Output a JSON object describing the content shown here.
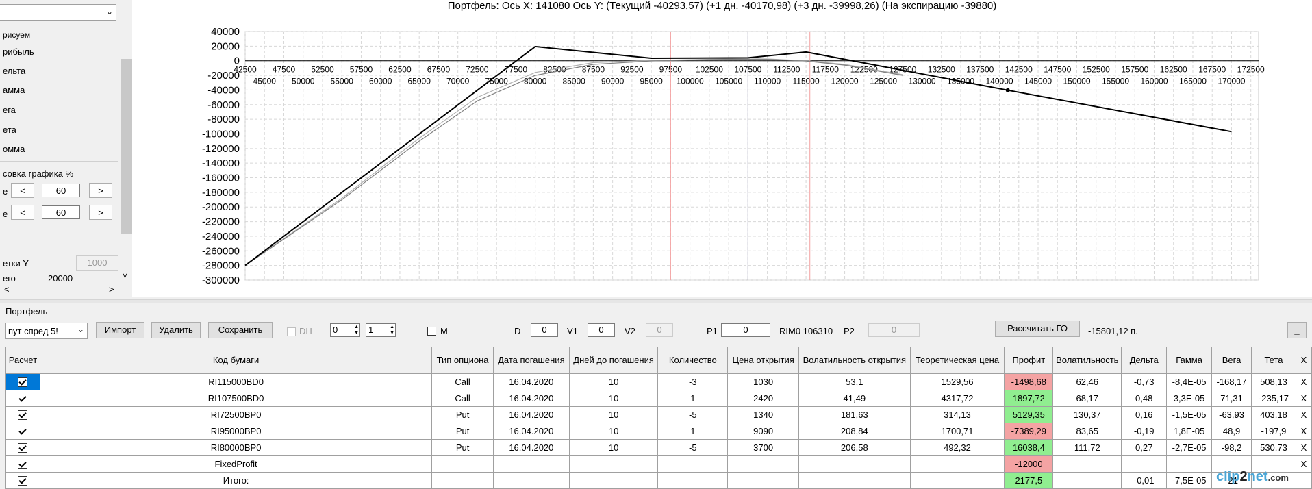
{
  "left_panel": {
    "items": [
      "рисуем",
      "рибыль",
      "ельта",
      "амма",
      "ега",
      "ета",
      "омма"
    ],
    "scale_label": "совка графика %",
    "row1_prefix": "е",
    "row2_prefix": "е",
    "btn_left": "<",
    "btn_right": ">",
    "value1": "60",
    "value2": "60",
    "grid_y_label": "етки Y",
    "grid_y_value": "1000",
    "total_label": "его",
    "total_value": "20000",
    "scroll_left": "<",
    "scroll_right": ">",
    "chevron": "˅"
  },
  "chart_title": "Портфель: Ось X: 141080 Ось Y:  (Текущий -40293,57)  (+1 дн. -40170,98)  (+3 дн. -39998,26)  (На экспирацию -39880)",
  "chart_data": {
    "type": "line",
    "y_ticks": [
      "40000",
      "20000",
      "0",
      "-20000",
      "-40000",
      "-60000",
      "-80000",
      "-100000",
      "-120000",
      "-140000",
      "-160000",
      "-180000",
      "-200000",
      "-220000",
      "-240000",
      "-260000",
      "-280000",
      "-300000"
    ],
    "x_ticks_top": [
      "42500",
      "47500",
      "52500",
      "57500",
      "62500",
      "67500",
      "72500",
      "77500",
      "82500",
      "87500",
      "92500",
      "97500",
      "102500",
      "107500",
      "112500",
      "117500",
      "122500",
      "127500",
      "132500",
      "137500",
      "142500",
      "147500",
      "152500",
      "157500",
      "162500",
      "167500",
      "172500"
    ],
    "x_ticks_bottom": [
      "45000",
      "50000",
      "55000",
      "60000",
      "65000",
      "70000",
      "75000",
      "80000",
      "85000",
      "90000",
      "95000",
      "100000",
      "105000",
      "110000",
      "115000",
      "120000",
      "125000",
      "130000",
      "135000",
      "140000",
      "145000",
      "150000",
      "155000",
      "160000",
      "165000",
      "170000"
    ],
    "xlim": [
      42500,
      173500
    ],
    "ylim": [
      -300000,
      40000
    ],
    "grid": true,
    "series": [
      {
        "color": "#000000",
        "points": [
          [
            42500,
            -280000
          ],
          [
            80000,
            19500
          ],
          [
            95000,
            3500
          ],
          [
            107500,
            4000
          ],
          [
            115000,
            12000
          ],
          [
            141080,
            -40293.57
          ],
          [
            170000,
            -97000
          ]
        ]
      },
      {
        "color": "#808080",
        "points": [
          [
            42500,
            -280000
          ],
          [
            55000,
            -190000
          ],
          [
            65000,
            -110000
          ],
          [
            72500,
            -55000
          ],
          [
            80000,
            -20000
          ],
          [
            87500,
            -5000
          ],
          [
            95000,
            -300
          ],
          [
            105000,
            2000
          ],
          [
            110000,
            2000
          ],
          [
            115000,
            -500
          ],
          [
            120000,
            -6000
          ],
          [
            127500,
            -20000
          ]
        ]
      },
      {
        "color": "#b0b0b0",
        "points": [
          [
            42500,
            -280000
          ],
          [
            55000,
            -188000
          ],
          [
            65000,
            -106000
          ],
          [
            72500,
            -50000
          ],
          [
            80000,
            -16000
          ],
          [
            87500,
            -2500
          ],
          [
            95000,
            300
          ],
          [
            105000,
            2500
          ],
          [
            110000,
            2500
          ],
          [
            115000,
            0
          ],
          [
            120000,
            -5000
          ],
          [
            127500,
            -19000
          ]
        ]
      }
    ],
    "vlines": [
      {
        "x": 97500,
        "color": "#f4a0a0"
      },
      {
        "x": 107500,
        "color": "#7a7a9a"
      },
      {
        "x": 115500,
        "color": "#f4a0a0"
      }
    ],
    "marker": {
      "x": 141080,
      "y": -40293.57
    }
  },
  "portfolio": {
    "group_label": "Портфель",
    "combo_value": "пут спред 5!",
    "btn_import": "Импорт",
    "btn_delete": "Удалить",
    "btn_save": "Сохранить",
    "dh_label": "DH",
    "spin1": "0",
    "spin2": "1",
    "m_label": "M",
    "d_label": "D",
    "d_value": "0",
    "v1_label": "V1",
    "v1_value": "0",
    "v2_label": "V2",
    "v2_value": "0",
    "p1_label": "P1",
    "p1_value": "0",
    "rim_label": "RIM0 106310",
    "p2_label": "P2",
    "p2_value": "0",
    "btn_go": "Рассчитать ГО",
    "go_value": "-15801,12 п.",
    "btn_min": "_"
  },
  "table": {
    "headers": [
      "Расчет",
      "Код бумаги",
      "Тип опциона",
      "Дата погашения",
      "Дней до погашения",
      "Количество",
      "Цена открытия",
      "Волатильность открытия",
      "Теоретическая цена",
      "Профит",
      "Волатильность",
      "Дельта",
      "Гамма",
      "Вега",
      "Тета",
      "X"
    ],
    "rows": [
      [
        "RI115000BD0",
        "Call",
        "16.04.2020",
        "10",
        "-3",
        "1030",
        "53,1",
        "1529,56",
        "-1498,68",
        "62,46",
        "-0,73",
        "-8,4E-05",
        "-168,17",
        "508,13",
        "X"
      ],
      [
        "RI107500BD0",
        "Call",
        "16.04.2020",
        "10",
        "1",
        "2420",
        "41,49",
        "4317,72",
        "1897,72",
        "68,17",
        "0,48",
        "3,3E-05",
        "71,31",
        "-235,17",
        "X"
      ],
      [
        "RI72500BP0",
        "Put",
        "16.04.2020",
        "10",
        "-5",
        "1340",
        "181,63",
        "314,13",
        "5129,35",
        "130,37",
        "0,16",
        "-1,5E-05",
        "-63,93",
        "403,18",
        "X"
      ],
      [
        "RI95000BP0",
        "Put",
        "16.04.2020",
        "10",
        "1",
        "9090",
        "208,84",
        "1700,71",
        "-7389,29",
        "83,65",
        "-0,19",
        "1,8E-05",
        "48,9",
        "-197,9",
        "X"
      ],
      [
        "RI80000BP0",
        "Put",
        "16.04.2020",
        "10",
        "-5",
        "3700",
        "206,58",
        "492,32",
        "16038,4",
        "111,72",
        "0,27",
        "-2,7E-05",
        "-98,2",
        "530,73",
        "X"
      ],
      [
        "FixedProfit",
        "",
        "",
        "",
        "",
        "",
        "",
        "",
        "-12000",
        "",
        "",
        "",
        "",
        "",
        "X"
      ],
      [
        "Итого:",
        "",
        "",
        "",
        "",
        "",
        "",
        "",
        "2177,5",
        "",
        "-0,01",
        "-7,5E-05",
        "-21",
        "",
        ""
      ]
    ],
    "profit_status": [
      "neg",
      "pos",
      "pos",
      "neg",
      "pos",
      "neg",
      "pos"
    ]
  },
  "watermark": {
    "part1": "clip",
    "part2": "2",
    "part3": "net",
    "part4": ".com"
  }
}
